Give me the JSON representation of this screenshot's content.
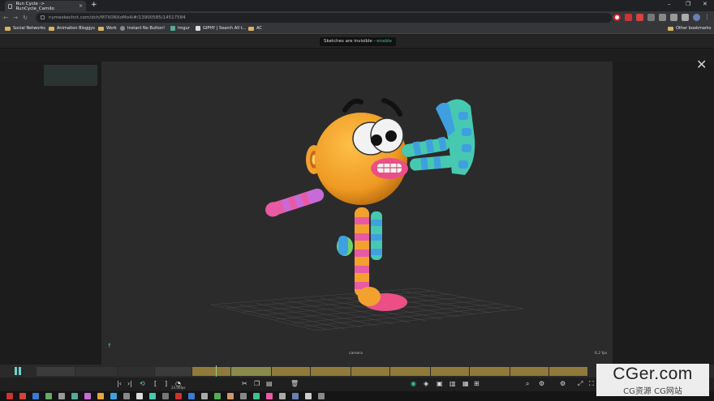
{
  "browser": {
    "tab_title": "Run Cycle -> RunCycle_Camilo",
    "tab_close": "×",
    "new_tab": "+",
    "url": "nymeskechnt.com/dch/M7X0NXoMo4/#/13900585/14517584",
    "window_minimize": "–",
    "window_maximize": "❐",
    "window_close": "✕",
    "nav_back": "←",
    "nav_forward": "→",
    "nav_reload": "↻",
    "bookmarks": [
      "Social Networks",
      "Animation Bloggys",
      "Work",
      "Instant No Button!",
      "Imgur",
      "GIPHY | Search All t...",
      "AC"
    ],
    "other_bookmarks": "Other bookmarks"
  },
  "app": {
    "toast": {
      "text": "Sketches are invisible - ",
      "link": "enable"
    },
    "viewport_bottom_label": "camera",
    "fps": "6.2 fps",
    "zoom_label": "24.00fps",
    "close_glyph": "✕",
    "axis_glyph": "↑"
  },
  "timeline": {
    "segments": [
      {
        "color": "#3b3b3b",
        "w": 48
      },
      {
        "color": "#333333",
        "w": 52
      },
      {
        "color": "#2f2f2f",
        "w": 46
      },
      {
        "color": "#3a3a3a",
        "w": 46
      },
      {
        "color": "#8f7a3a",
        "w": 48
      },
      {
        "color": "#8a8a4a",
        "w": 50
      },
      {
        "color": "#8f7a3a",
        "w": 48
      },
      {
        "color": "#8f7a3a",
        "w": 50
      },
      {
        "color": "#8f7a3a",
        "w": 48
      },
      {
        "color": "#8f7a3a",
        "w": 50
      },
      {
        "color": "#8f7a3a",
        "w": 48
      },
      {
        "color": "#8f7a3a",
        "w": 50
      },
      {
        "color": "#8f7a3a",
        "w": 48
      },
      {
        "color": "#8f7a3a",
        "w": 48
      }
    ]
  },
  "toolbar": {
    "icons": [
      "key-prev",
      "key-next",
      "loop",
      "bracket-left",
      "bracket-right",
      "camera",
      "scissors",
      "copy",
      "paste",
      "delete",
      "eye",
      "layers",
      "lock",
      "group",
      "mesh",
      "frame",
      "grid",
      "search",
      "settings",
      "settings-2",
      "expand",
      "fullscreen"
    ]
  },
  "watermark": {
    "line1": "CGer.com",
    "line2": "CG资源 CG网站"
  },
  "colors": {
    "accent": "#39c48a",
    "playhead": "#8fd18a",
    "orange_body": "#f2a12e",
    "pink_lips": "#e8417a"
  }
}
